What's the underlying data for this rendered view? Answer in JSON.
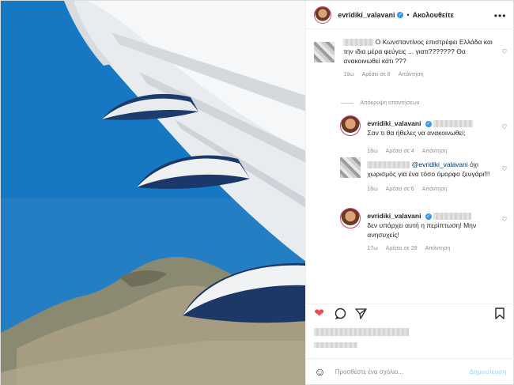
{
  "post": {
    "username": "evridiki_valavani",
    "follow_label": "Ακολουθείτε",
    "separator": "•"
  },
  "comments": [
    {
      "text": "Ο Κωνσταντίνος επιστρέφει Ελλάδα και την ιδια μέρα φεύγεις ... γιατι??????? Θα ανακοινωθεί κάτι ???",
      "time": "19ω",
      "likes": "Αρέσει σε 8",
      "reply": "Απάντηση"
    }
  ],
  "hide_replies_label": "Απόκρυψη απαντήσεων",
  "replies": [
    {
      "username": "evridiki_valavani",
      "text": "Σαν τι θα ήθελες να ανακοινωθεί;",
      "time": "18ω",
      "likes": "Αρέσει σε 4",
      "reply": "Απάντηση"
    },
    {
      "mention": "@evridiki_valavani",
      "text": "όχι χωρισμός για ένα τόσο όμορφο ζευγάρι!!!",
      "time": "18ω",
      "likes": "Αρέσει σε 6",
      "reply": "Απάντηση"
    },
    {
      "username": "evridiki_valavani",
      "text": "δεν υπάρχει αυτή η περίπτωση! Μην ανησυχείς!",
      "time": "17ω",
      "likes": "Αρέσει σε 29",
      "reply": "Απάντηση"
    }
  ],
  "add_comment": {
    "placeholder": "Προσθέστε ένα σχόλιο...",
    "post_label": "Δημοσίευση"
  },
  "icons": {
    "like": "heart-filled-icon",
    "comment": "comment-bubble-icon",
    "share": "send-icon",
    "save": "bookmark-icon",
    "more": "more-options-icon",
    "emoji": "smiley-icon"
  },
  "colors": {
    "liked": "#ed4956",
    "verified": "#3897f0",
    "mention": "#00376b",
    "post_button": "#b2dffc"
  }
}
